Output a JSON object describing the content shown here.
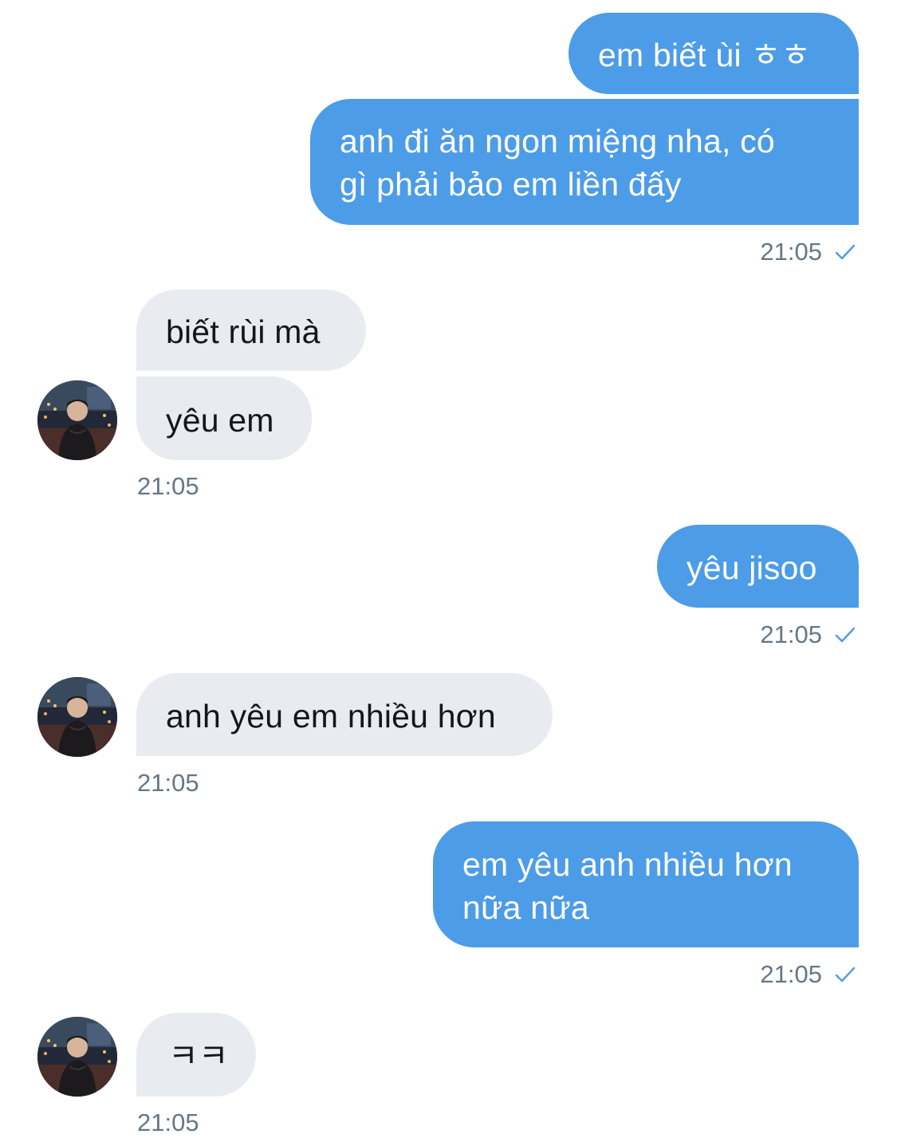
{
  "colors": {
    "outgoing_bubble": "#4c9ce8",
    "incoming_bubble": "#e8ebf0",
    "timestamp": "#657786",
    "read_check": "#4c9ce8"
  },
  "messages": [
    {
      "direction": "out",
      "text": "em biết ùi ㅎㅎ"
    },
    {
      "direction": "out",
      "text": "anh đi ăn ngon miệng nha, có\ngì phải bảo em liền đấy"
    },
    {
      "direction": "out_time",
      "time": "21:05",
      "status_icon": "check-icon"
    },
    {
      "direction": "in",
      "text": "biết rùi mà"
    },
    {
      "direction": "in",
      "text": "yêu em"
    },
    {
      "direction": "in_time",
      "time": "21:05"
    },
    {
      "direction": "out",
      "text": "yêu jisoo"
    },
    {
      "direction": "out_time",
      "time": "21:05",
      "status_icon": "check-icon"
    },
    {
      "direction": "in",
      "text": "anh yêu em nhiều hơn"
    },
    {
      "direction": "in_time",
      "time": "21:05"
    },
    {
      "direction": "out",
      "text": "em yêu anh nhiều hơn\nnữa nữa"
    },
    {
      "direction": "out_time",
      "time": "21:05",
      "status_icon": "check-icon"
    },
    {
      "direction": "in",
      "text": "ㅋㅋ"
    },
    {
      "direction": "in_time",
      "time": "21:05"
    }
  ]
}
